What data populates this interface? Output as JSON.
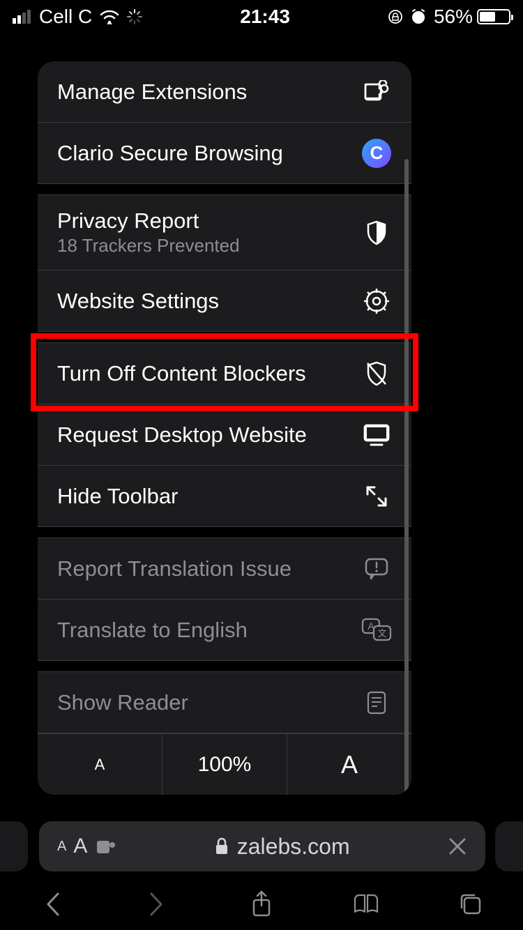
{
  "status": {
    "carrier": "Cell C",
    "time": "21:43",
    "battery_pct": "56%",
    "battery_fill": 56
  },
  "menu": {
    "manage_extensions": "Manage Extensions",
    "clario": "Clario Secure Browsing",
    "privacy_report": "Privacy Report",
    "privacy_sub": "18 Trackers Prevented",
    "website_settings": "Website Settings",
    "content_blockers": "Turn Off Content Blockers",
    "request_desktop": "Request Desktop Website",
    "hide_toolbar": "Hide Toolbar",
    "report_translation": "Report Translation Issue",
    "translate": "Translate to English",
    "show_reader": "Show Reader",
    "zoom_level": "100%"
  },
  "url_bar": {
    "aa": "AA",
    "domain": "zalebs.com"
  }
}
